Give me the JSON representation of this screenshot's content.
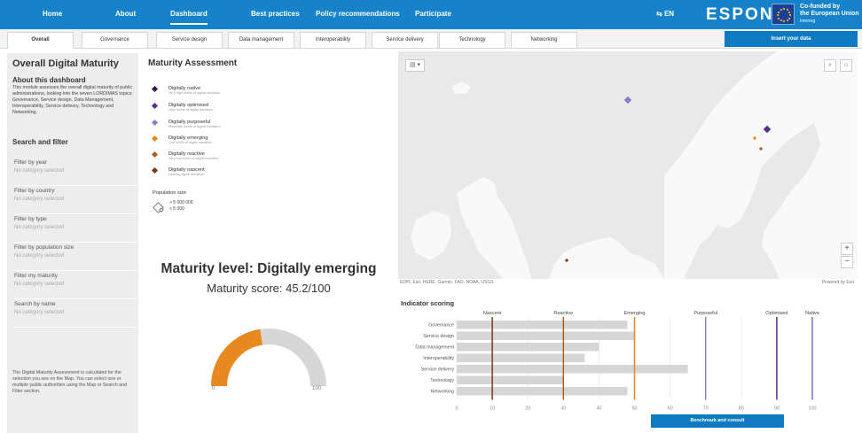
{
  "topnav": {
    "items": [
      {
        "label": "Home",
        "active": false
      },
      {
        "label": "About",
        "active": false
      },
      {
        "label": "Dashboard",
        "active": true
      },
      {
        "label": "Best practices",
        "active": false
      },
      {
        "label": "Policy recommendations",
        "active": false
      },
      {
        "label": "Participate",
        "active": false
      }
    ],
    "lang": "EN",
    "logo": "ESPON",
    "eu_line1": "Co-funded by",
    "eu_line2": "the European Union",
    "eu_line3": "Interreg"
  },
  "tabs": [
    "Overall",
    "Governance",
    "Service design",
    "Data management",
    "Interoperability",
    "Service delivery",
    "Technology",
    "Networking"
  ],
  "insert_button": "Insert your data",
  "sidebar": {
    "title": "Overall Digital Maturity",
    "about_heading": "About this dashboard",
    "about_text": "This module assesses the overall digital maturity of public administrations, looking into the seven LORDIMAS topics: Governance, Service design, Data Management, Interoperability, Service delivery, Technology and Networking.",
    "search_heading": "Search and filter",
    "filters": [
      {
        "label": "Filter by year",
        "value": "No category selected"
      },
      {
        "label": "Filter by country",
        "value": "No category selected"
      },
      {
        "label": "Filter by type",
        "value": "No category selected"
      },
      {
        "label": "Filter by population size",
        "value": "No category selected"
      },
      {
        "label": "Filter my maturity",
        "value": "No category selected"
      },
      {
        "label": "Search by name",
        "value": "No category selected"
      }
    ],
    "footer_text": "The Digital Maturity Assessment is calculated for the selection you see on the Map. You can select one or multiple public authorities using the Map or Search and Filter section."
  },
  "assessment": {
    "title": "Maturity Assessment",
    "legend": [
      {
        "name": "Digitally native",
        "desc": "Very high levels of digital transition",
        "color": "#3a1450"
      },
      {
        "name": "Digitally optimised",
        "desc": "High levels of digital transition",
        "color": "#5e2b8c"
      },
      {
        "name": "Digitally purposeful",
        "desc": "Moderate levels of digital transition",
        "color": "#8c7cc8"
      },
      {
        "name": "Digitally emerging",
        "desc": "Low levels of digital transition",
        "color": "#e8891f"
      },
      {
        "name": "Digitally reactive",
        "desc": "Very low levels of digital transition",
        "color": "#b85c1e"
      },
      {
        "name": "Digitally nascent",
        "desc": "Lacking digital transition",
        "color": "#7a3a12"
      }
    ],
    "population_title": "Population size",
    "population_large": "> 5 000 000",
    "population_small": "< 5 000",
    "maturity_level": "Maturity level: Digitally emerging",
    "maturity_score": "Maturity score: 45.2/100",
    "score_value": 45.2,
    "gauge_min": "0",
    "gauge_max": "100",
    "gauge_color": "#e8891f"
  },
  "map": {
    "attribution": "EDPI, Esri, HERE, Garmin, FAO, NOAA, USGS",
    "powered": "Powered by Esri",
    "zoom_in": "+",
    "zoom_out": "−"
  },
  "indicator": {
    "title": "Indicator scoring",
    "button": "Benchmark and consult",
    "chart_data": {
      "type": "bar",
      "orientation": "horizontal",
      "categories": [
        "Governance",
        "Service design",
        "Data management",
        "Interoperability",
        "Service delivery",
        "Technology",
        "Networking"
      ],
      "values": [
        48,
        50,
        40,
        36,
        65,
        30,
        48
      ],
      "xlim": [
        0,
        100
      ],
      "xticks": [
        0,
        10,
        20,
        30,
        40,
        50,
        60,
        70,
        80,
        90,
        100
      ],
      "thresholds": [
        {
          "label": "Nascent",
          "value": 10,
          "color": "#7a3a12"
        },
        {
          "label": "Reactive",
          "value": 30,
          "color": "#b85c1e"
        },
        {
          "label": "Emerging",
          "value": 50,
          "color": "#e8891f"
        },
        {
          "label": "Purposeful",
          "value": 70,
          "color": "#8c7cc8"
        },
        {
          "label": "Optimised",
          "value": 90,
          "color": "#5e2b8c"
        },
        {
          "label": "Native",
          "value": 100,
          "color": "#7d6cc4"
        }
      ]
    }
  }
}
